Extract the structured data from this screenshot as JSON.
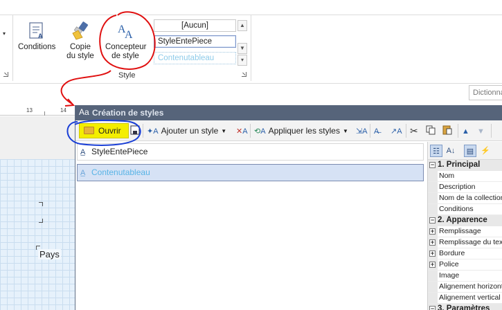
{
  "ribbon": {
    "buttons": [
      {
        "label": "Conditions",
        "icon": "conditions-icon"
      },
      {
        "label": "Copie du style",
        "icon": "copy-style-icon"
      },
      {
        "label": "Concepteur de style",
        "icon": "style-designer-icon"
      }
    ],
    "group_label": "Style",
    "style_list": [
      "[Aucun]",
      "StyleEntePiece",
      "Contenutableau"
    ]
  },
  "side_panel": {
    "dictionnaire_tab": "Dictionnaire"
  },
  "ruler": {
    "ticks": [
      "13",
      "14"
    ]
  },
  "page": {
    "pays_label": "Pays"
  },
  "window": {
    "title": "Création de styles",
    "toolbar": {
      "ouvrir": "Ouvrir",
      "ajouter_style": "Ajouter un style",
      "appliquer_styles": "Appliquer les styles"
    },
    "styles": [
      "StyleEntePiece",
      "Contenutableau"
    ],
    "properties": [
      {
        "type": "category",
        "label": "1. Principal",
        "expanded": true
      },
      {
        "type": "prop",
        "label": "Nom"
      },
      {
        "type": "prop",
        "label": "Description"
      },
      {
        "type": "prop",
        "label": "Nom de la collection"
      },
      {
        "type": "prop",
        "label": "Conditions"
      },
      {
        "type": "category",
        "label": "2. Apparence",
        "expanded": true
      },
      {
        "type": "prop",
        "label": "Remplissage",
        "expandable": true
      },
      {
        "type": "prop",
        "label": "Remplissage du texte",
        "expandable": true
      },
      {
        "type": "prop",
        "label": "Bordure",
        "expandable": true
      },
      {
        "type": "prop",
        "label": "Police",
        "expandable": true
      },
      {
        "type": "prop",
        "label": "Image"
      },
      {
        "type": "prop",
        "label": "Alignement horizontal"
      },
      {
        "type": "prop",
        "label": "Alignement vertical"
      },
      {
        "type": "category",
        "label": "3. Paramètres",
        "expanded": true
      }
    ]
  },
  "colors": {
    "window_title_bg": "#56647a",
    "highlight_yellow": "#f4ee00",
    "selected_row_bg": "#d6e2f5",
    "annotation_red": "#e01010",
    "annotation_blue": "#1a3fd6"
  }
}
